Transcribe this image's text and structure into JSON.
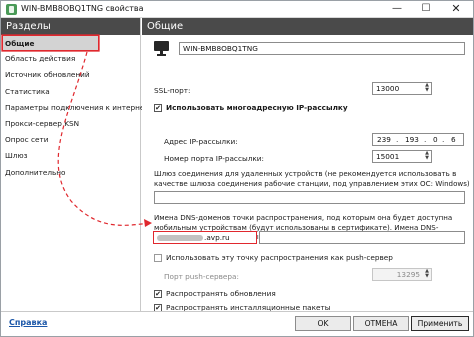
{
  "window": {
    "title": "WIN-BMB8OBQ1TNG свойства",
    "min_glyph": "—",
    "max_glyph": "☐",
    "close_glyph": "✕"
  },
  "sidebar": {
    "header": "Разделы",
    "items": [
      {
        "label": "Общие",
        "active": true
      },
      {
        "label": "Область действия"
      },
      {
        "label": "Источник обновлений"
      },
      {
        "label": "Статистика"
      },
      {
        "label": "Параметры подключения к интернету"
      },
      {
        "label": "Прокси-сервер KSN"
      },
      {
        "label": "Опрос сети"
      },
      {
        "label": "Шлюз"
      },
      {
        "label": "Дополнительно"
      }
    ]
  },
  "main": {
    "header": "Общие",
    "host_name": "WIN-BMB8OBQ1TNG",
    "ssl_port_label": "SSL-порт:",
    "ssl_port_value": "13000",
    "multicast_checkbox_label": "Использовать многоадресную IP-рассылку",
    "multicast_checked": true,
    "multicast_address_label": "Адрес IP-рассылки:",
    "multicast_address": [
      "239",
      "193",
      "0",
      "6"
    ],
    "multicast_port_label": "Номер порта IP-рассылки:",
    "multicast_port_value": "15001",
    "gateway_desc": "Шлюз соединения для удаленных устройств (не рекомендуется использовать в качестве шлюза соединения рабочие станции, под управлением этих ОС: Windows)",
    "gateway_value": "",
    "dns_desc": "Имена DNS-доменов точки распространения, под которым она будет доступна мобильным устройствам (будут использованы в сертификате). Имена DNS-доменов в списке разделены запятыми.",
    "dns_value_suffix": ".avp.ru",
    "push_checkbox_label": "Использовать эту точку распространения как push-сервер",
    "push_checked": false,
    "push_port_label": "Порт push-сервера:",
    "push_port_value": "13295",
    "distribute_updates_label": "Распространять обновления",
    "distribute_updates_checked": true,
    "distribute_packages_label": "Распространять инсталляционные пакеты",
    "distribute_packages_checked": true,
    "check_glyph": "✔",
    "spin_up": "▲",
    "spin_down": "▼"
  },
  "footer": {
    "help": "Справка",
    "ok": "OK",
    "cancel": "ОТМЕНА",
    "apply": "Применить"
  },
  "colors": {
    "header_bg": "#4a4a4a",
    "highlight": "#e0282e",
    "link": "#1a56a8"
  }
}
